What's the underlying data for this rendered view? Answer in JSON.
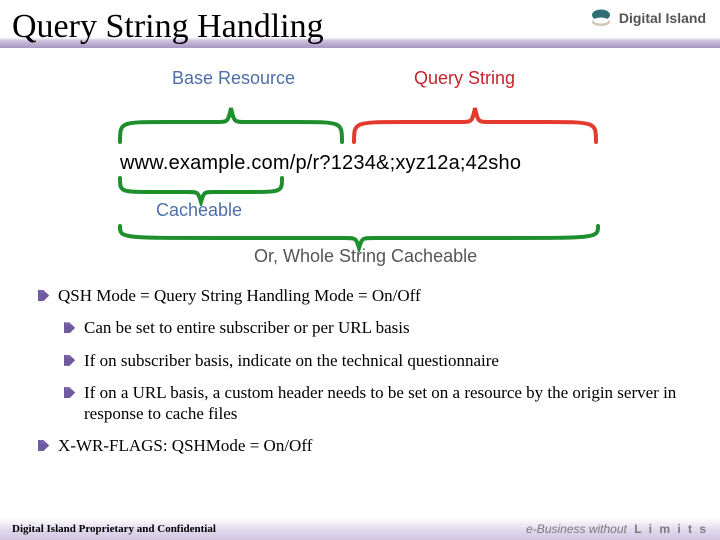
{
  "brand_name": "Digital Island",
  "title": "Query String Handling",
  "diagram": {
    "base_label": "Base Resource",
    "query_label": "Query String",
    "url": "www.example.com/p/r?1234&;xyz12a;42sho",
    "cacheable_label": "Cacheable",
    "whole_label": "Or, Whole String Cacheable"
  },
  "colors": {
    "blue": "#4e6ea8",
    "red": "#c3242b",
    "green": "#2f9a3e",
    "brace_red": "#e23b2e",
    "brace_green": "#1f8f2e"
  },
  "bullets": {
    "b1": "QSH Mode = Query String Handling Mode = On/Off",
    "b1_1": "Can be set to entire subscriber or per URL basis",
    "b1_2": "If on subscriber basis, indicate on the technical questionnaire",
    "b1_3": "If on a URL basis, a custom header needs to be set on a resource by the origin server in response to cache files",
    "b2": "X-WR-FLAGS: QSHMode = On/Off"
  },
  "footer": {
    "left": "Digital Island Proprietary and Confidential",
    "right_italic": "e-Business without",
    "right_caps": "L i m i t s"
  }
}
